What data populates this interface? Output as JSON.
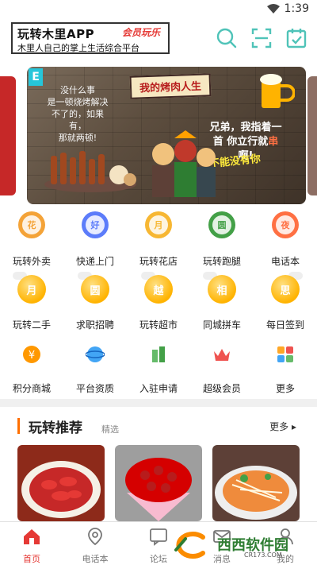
{
  "status_bar": {
    "time": "1:39"
  },
  "header": {
    "app_title": "玩转木里APP",
    "badge_text": "会员玩乐",
    "slogan": "木里人自己的掌上生活综合平台",
    "icons": [
      "search-icon",
      "scan-icon",
      "checkin-calendar-icon"
    ]
  },
  "banner": {
    "tag": "E",
    "sign": "我的烤肉人生",
    "caption_left": "没什么事\n是一顿烧烤解决\n不了的，如果有，\n那就两顿!",
    "caption_right_a": "兄弟，我指着一首",
    "caption_right_b": "你立行就",
    "caption_right_red": "串",
    "caption_right_c": "啊!",
    "caption_small": "不能没有你"
  },
  "grid_row1": [
    {
      "icon": "花",
      "label": "玩转外卖",
      "color": "#f4a338"
    },
    {
      "icon": "好",
      "label": "快递上门",
      "color": "#5c7cfa"
    },
    {
      "icon": "月",
      "label": "玩转花店",
      "color": "#f7b733"
    },
    {
      "icon": "圆",
      "label": "玩转跑腿",
      "color": "#43a047"
    },
    {
      "icon": "夜",
      "label": "电话本",
      "color": "#ff7043"
    }
  ],
  "grid_row2": [
    {
      "icon": "月",
      "label": "玩转二手"
    },
    {
      "icon": "圆",
      "label": "求职招聘"
    },
    {
      "icon": "越",
      "label": "玩转超市"
    },
    {
      "icon": "相",
      "label": "同城拼车"
    },
    {
      "icon": "思",
      "label": "每日签到"
    }
  ],
  "grid_row3": [
    {
      "icon": "points-mall-icon",
      "label": "积分商城",
      "color": "#ff9800"
    },
    {
      "icon": "platform-credentials-icon",
      "label": "平台资质",
      "color": "#42a5f5"
    },
    {
      "icon": "join-apply-icon",
      "label": "入驻申请",
      "color": "#66bb6a"
    },
    {
      "icon": "crown-icon",
      "label": "超级会员",
      "color": "#ef5350"
    },
    {
      "icon": "more-grid-icon",
      "label": "更多",
      "color": "#ffa726"
    }
  ],
  "recommend": {
    "title": "玩转推荐",
    "subtitle": "精选",
    "more": "更多 ▸"
  },
  "bottom_nav": [
    {
      "icon": "home-icon",
      "label": "首页",
      "active": true
    },
    {
      "icon": "phonebook-icon",
      "label": "电话本",
      "active": false
    },
    {
      "icon": "forum-icon",
      "label": "论坛",
      "active": false
    },
    {
      "icon": "message-icon",
      "label": "消息",
      "active": false
    },
    {
      "icon": "profile-icon",
      "label": "我的",
      "active": false
    }
  ],
  "watermark": {
    "brand": "西西软件园",
    "site": "CR173.COM"
  },
  "colors": {
    "accent": "#4fc3b8",
    "brand_red": "#e53935",
    "section_bar": "#ff6f00"
  }
}
